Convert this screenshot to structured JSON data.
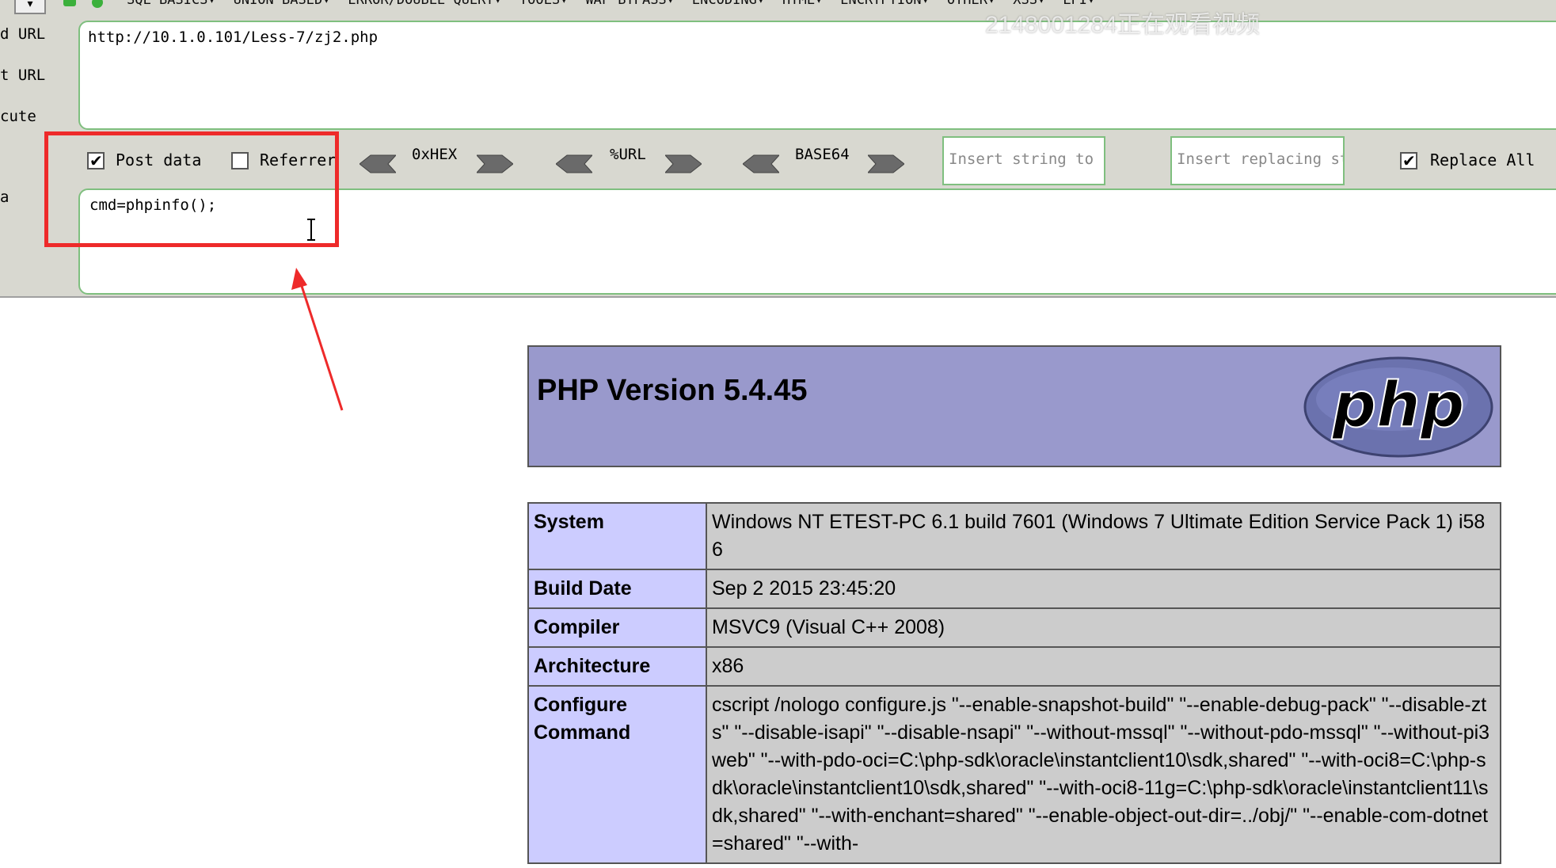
{
  "menubar": {
    "dropdown_icon": "chevron-down-icon",
    "items": [
      "SQL BASICS▾",
      "UNION BASED▾",
      "ERROR/DOUBLE QUERY▾",
      "TOOLS▾",
      "WAF BYPASS▾",
      "ENCODING▾",
      "HTML▾",
      "ENCRYPTION▾",
      "OTHER▾",
      "XSS▾",
      "LFI▾"
    ]
  },
  "side_labels": {
    "load_url": "d URL",
    "split_url": "t URL",
    "execute": "cute",
    "post": "a"
  },
  "url_field": {
    "value": "http://10.1.0.101/Less-7/zj2.php"
  },
  "options": {
    "post_data": {
      "label": "Post data",
      "checked": true
    },
    "referrer": {
      "label": "Referrer",
      "checked": false
    },
    "hex": {
      "label": "0xHEX"
    },
    "url": {
      "label": "%URL"
    },
    "base64": {
      "label": "BASE64"
    },
    "insert_string_placeholder": "Insert string to replace",
    "insert_replacing_placeholder": "Insert replacing string",
    "replace_all": {
      "label": "Replace All",
      "checked": true
    }
  },
  "post_field": {
    "value": "cmd=phpinfo();"
  },
  "watermark": "2148001284正在观看视频",
  "php": {
    "title": "PHP Version 5.4.45",
    "logo_text": "php",
    "rows": [
      {
        "key": "System",
        "value": "Windows NT ETEST-PC 6.1 build 7601 (Windows 7 Ultimate Edition Service Pack 1) i586"
      },
      {
        "key": "Build Date",
        "value": "Sep 2 2015 23:45:20"
      },
      {
        "key": "Compiler",
        "value": "MSVC9 (Visual C++ 2008)"
      },
      {
        "key": "Architecture",
        "value": "x86"
      },
      {
        "key": "Configure Command",
        "value": "cscript /nologo configure.js \"--enable-snapshot-build\" \"--enable-debug-pack\" \"--disable-zts\" \"--disable-isapi\" \"--disable-nsapi\" \"--without-mssql\" \"--without-pdo-mssql\" \"--without-pi3web\" \"--with-pdo-oci=C:\\php-sdk\\oracle\\instantclient10\\sdk,shared\" \"--with-oci8=C:\\php-sdk\\oracle\\instantclient10\\sdk,shared\" \"--with-oci8-11g=C:\\php-sdk\\oracle\\instantclient11\\sdk,shared\" \"--with-enchant=shared\" \"--enable-object-out-dir=../obj/\" \"--enable-com-dotnet=shared\" \"--with-"
      }
    ]
  },
  "colors": {
    "php_header_bg": "#9999cc",
    "php_key_bg": "#ccccff",
    "php_value_bg": "#cccccc",
    "highlight": "#ee2a2a",
    "field_border": "#7fbf7f"
  }
}
